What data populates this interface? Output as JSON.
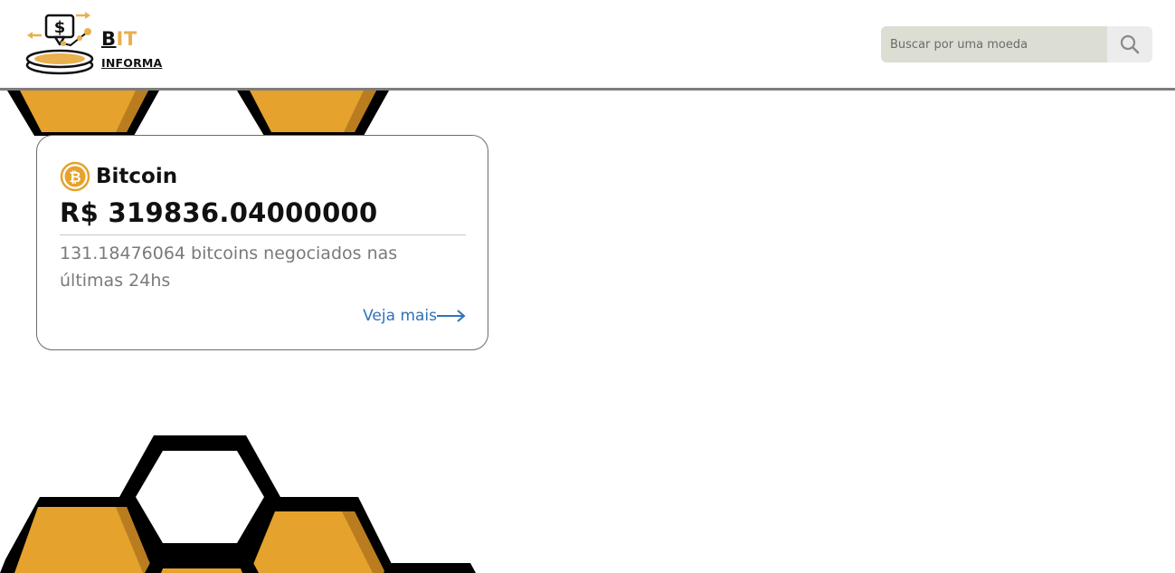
{
  "header": {
    "logo": {
      "icon": "coin-exchange-logo-icon",
      "brand_part1": "B",
      "brand_part2": "IT",
      "brand_sub": "INFORMA"
    },
    "search": {
      "placeholder": "Buscar por uma moeda",
      "value": "",
      "icon": "search-icon"
    }
  },
  "card": {
    "coin_icon": "bitcoin-icon",
    "coin_name": "Bitcoin",
    "price": "R$ 319836.04000000",
    "volume": "131.18476064 bitcoins negociados nas últimas 24hs",
    "more_label": "Veja mais",
    "more_icon": "arrow-right-icon"
  },
  "colors": {
    "accent": "#E5A22C",
    "dark": "#000000",
    "link": "#2E73B8",
    "search_bg": "#DCDDD3"
  }
}
